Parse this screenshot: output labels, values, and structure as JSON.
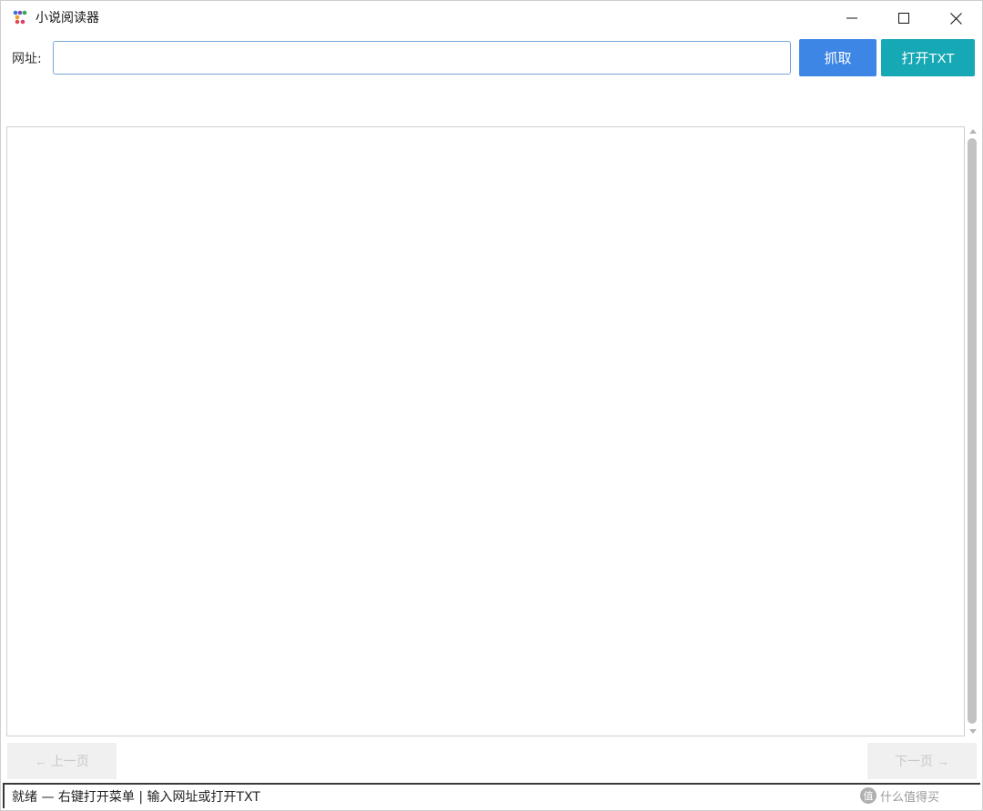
{
  "window": {
    "title": "小说阅读器"
  },
  "toolbar": {
    "url_label": "网址:",
    "url_value": "",
    "fetch_label": "抓取",
    "open_txt_label": "打开TXT"
  },
  "pager": {
    "prev_label": "← 上一页",
    "next_label": "下一页 →"
  },
  "status": {
    "text": "就绪 — 右键打开菜单 | 输入网址或打开TXT"
  },
  "watermark": {
    "badge": "值",
    "text": "什么值得买"
  },
  "colors": {
    "fetch_button": "#3d86e6",
    "open_button": "#17a8b5",
    "input_border": "#7aa7d6"
  }
}
